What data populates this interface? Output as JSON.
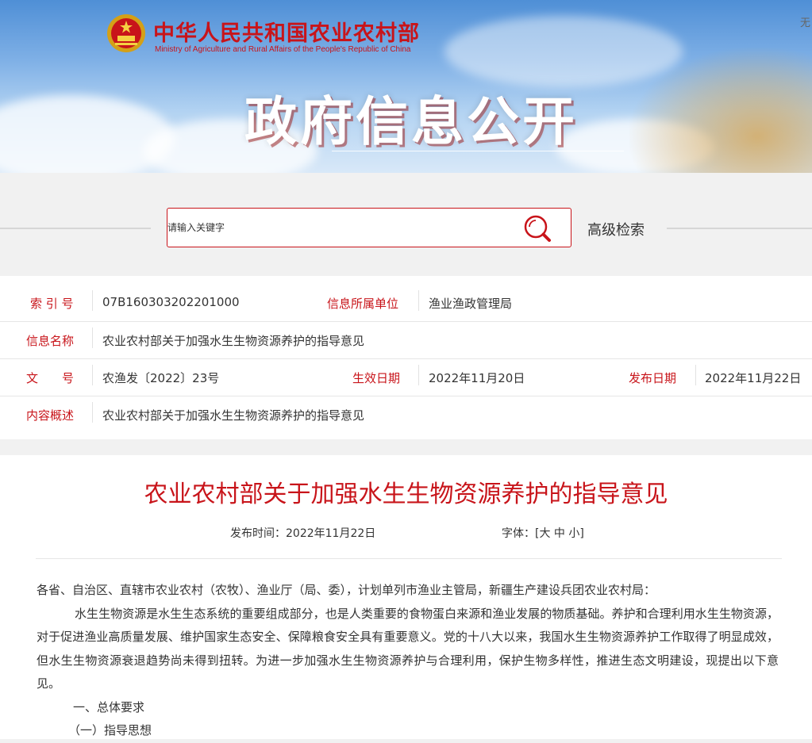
{
  "header": {
    "ministry_cn": "中华人民共和国农业农村部",
    "ministry_en": "Ministry of Agriculture and Rural Affairs of the People's Republic of China",
    "top_corner": "无",
    "banner_title": "政府信息公开"
  },
  "search": {
    "placeholder": "请输入关键字",
    "advanced_label": "高级检索"
  },
  "meta": {
    "index_label": "索 引 号",
    "index_value": "07B160303202201000",
    "dept_label": "信息所属单位",
    "dept_value": "渔业渔政管理局",
    "name_label": "信息名称",
    "name_value": "农业农村部关于加强水生生物资源养护的指导意见",
    "docno_label": "文　　号",
    "docno_value": "农渔发〔2022〕23号",
    "effective_label": "生效日期",
    "effective_value": "2022年11月20日",
    "publish_label": "发布日期",
    "publish_value": "2022年11月22日",
    "summary_label": "内容概述",
    "summary_value": "农业农村部关于加强水生生物资源养护的指导意见"
  },
  "article": {
    "title": "农业农村部关于加强水生生物资源养护的指导意见",
    "publish_time": "发布时间：2022年11月22日",
    "font_label": "字体：",
    "font_open": "[",
    "font_large": "大",
    "font_medium": "中",
    "font_small": "小",
    "font_close": "]",
    "paragraphs": {
      "p0": "各省、自治区、直辖市农业农村（农牧）、渔业厅（局、委），计划单列市渔业主管局，新疆生产建设兵团农业农村局：",
      "p1": "水生生物资源是水生生态系统的重要组成部分，也是人类重要的食物蛋白来源和渔业发展的物质基础。养护和合理利用水生生物资源，对于促进渔业高质量发展、维护国家生态安全、保障粮食安全具有重要意义。党的十八大以来，我国水生生物资源养护工作取得了明显成效，但水生生物资源衰退趋势尚未得到扭转。为进一步加强水生生物资源养护与合理利用，保护生物多样性，推进生态文明建设，现提出以下意见。",
      "p2": "一、总体要求",
      "p3": "（一）指导思想"
    }
  },
  "colors": {
    "accent_red": "#c8141a",
    "page_bg": "#f1f1f1"
  },
  "icons": {
    "emblem": "national-emblem-icon",
    "search": "search-icon"
  }
}
